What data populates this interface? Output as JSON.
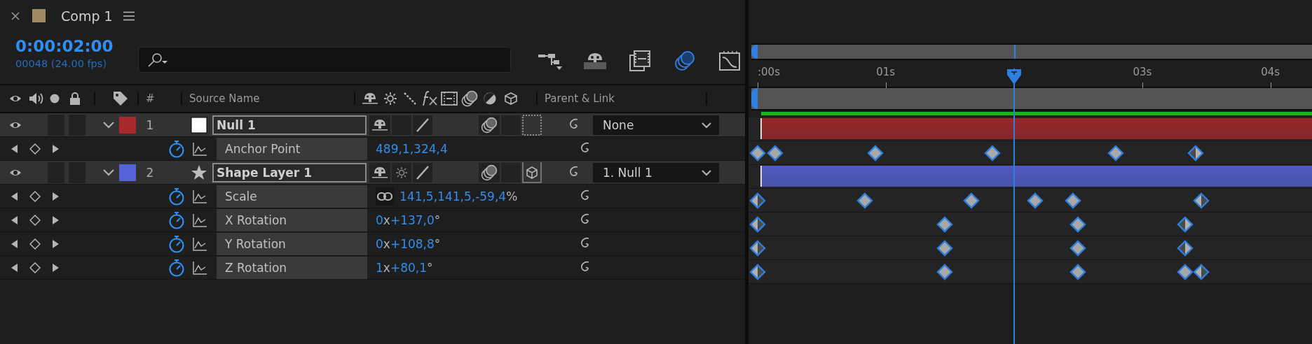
{
  "tab": {
    "title": "Comp 1"
  },
  "timecode": "0:00:02:00",
  "frame_info": "00048 (24.00 fps)",
  "playhead": {
    "level": 0.463
  },
  "toolbar": [
    {
      "kind": "flowchart",
      "selected": false
    },
    {
      "kind": "shy",
      "selected": false
    },
    {
      "kind": "frame_blend",
      "selected": false
    },
    {
      "kind": "motion_blur",
      "selected": true
    },
    {
      "kind": "graph_editor",
      "selected": false
    }
  ],
  "columns": {
    "number": "#",
    "source_name": "Source Name",
    "parent": "Parent & Link"
  },
  "ruler": [
    {
      "label": ":00s",
      "level": 0
    },
    {
      "label": "01s",
      "level": 0.231
    },
    {
      "label": "03s",
      "level": 0.694
    },
    {
      "label": "04s",
      "level": 0.925
    }
  ],
  "layers": [
    {
      "number": "1",
      "name": "Null 1",
      "color": "#a8282c",
      "kind": "null",
      "expanded": true,
      "solo": false,
      "locked": false,
      "adjustment": false,
      "collapse": false,
      "three_d": false,
      "parent": "None",
      "properties": [
        {
          "name": "Anchor Point",
          "value": "489,1,324,4",
          "constrain": false,
          "keyframes": [
            {
              "level": 0,
              "kind": "linear"
            },
            {
              "level": 0.031,
              "kind": "linear"
            },
            {
              "level": 0.212,
              "kind": "linear"
            },
            {
              "level": 0.424,
              "kind": "linear"
            },
            {
              "level": 0.646,
              "kind": "linear"
            },
            {
              "level": 0.79,
              "kind": "ease_in"
            }
          ]
        }
      ]
    },
    {
      "number": "2",
      "name": "Shape Layer 1",
      "color": "#5663d8",
      "kind": "shape",
      "expanded": true,
      "solo": false,
      "locked": false,
      "adjustment": false,
      "collapse": true,
      "three_d": true,
      "parent": "1. Null 1",
      "properties": [
        {
          "name": "Scale",
          "value": "141,5,141,5,-59,4%",
          "constrain": true,
          "keyframes": [
            {
              "level": 0,
              "kind": "ease_out"
            },
            {
              "level": 0.193,
              "kind": "linear"
            },
            {
              "level": 0.386,
              "kind": "linear"
            },
            {
              "level": 0.501,
              "kind": "linear"
            },
            {
              "level": 0.569,
              "kind": "linear"
            },
            {
              "level": 0.8,
              "kind": "ease_out"
            }
          ]
        },
        {
          "name": "X Rotation",
          "value": "0x+137,0°",
          "constrain": false,
          "keyframes": [
            {
              "level": 0,
              "kind": "ease_out"
            },
            {
              "level": 0.337,
              "kind": "linear"
            },
            {
              "level": 0.578,
              "kind": "linear"
            },
            {
              "level": 0.771,
              "kind": "ease_in"
            }
          ]
        },
        {
          "name": "Y Rotation",
          "value": "0x+108,8°",
          "constrain": false,
          "keyframes": [
            {
              "level": 0,
              "kind": "ease_out"
            },
            {
              "level": 0.337,
              "kind": "linear"
            },
            {
              "level": 0.578,
              "kind": "linear"
            },
            {
              "level": 0.771,
              "kind": "ease_in"
            }
          ]
        },
        {
          "name": "Z Rotation",
          "value": "1x+80,1°",
          "constrain": false,
          "keyframes": [
            {
              "level": 0,
              "kind": "ease_out"
            },
            {
              "level": 0.337,
              "kind": "linear"
            },
            {
              "level": 0.578,
              "kind": "linear"
            },
            {
              "level": 0.771,
              "kind": "linear"
            },
            {
              "level": 0.8,
              "kind": "ease_out"
            }
          ]
        }
      ]
    }
  ]
}
